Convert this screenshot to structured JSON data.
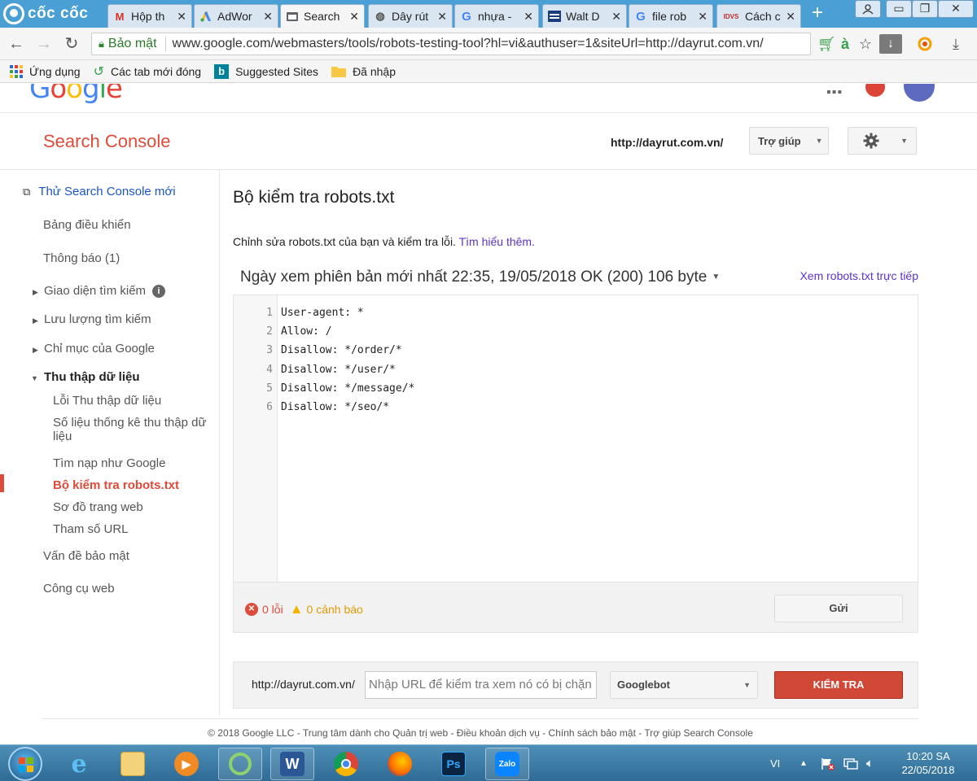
{
  "browser": {
    "brand": "cốc cốc",
    "tabs": [
      {
        "label": "Hộp th",
        "icon": "gmail-icon"
      },
      {
        "label": "AdWor",
        "icon": "adwords-icon"
      },
      {
        "label": "Search",
        "icon": "search-console-icon"
      },
      {
        "label": "Dây rút",
        "icon": "site-icon"
      },
      {
        "label": "nhựa -",
        "icon": "google-icon"
      },
      {
        "label": "Walt D",
        "icon": "news-icon"
      },
      {
        "label": "file rob",
        "icon": "google-icon"
      },
      {
        "label": "Cách c",
        "icon": "idvs-icon"
      }
    ],
    "idvs_text": "IDVS",
    "secure_label": "Bảo mật",
    "url": "www.google.com/webmasters/tools/robots-testing-tool?hl=vi&authuser=1&siteUrl=http://dayrut.com.vn/",
    "addon_letter": "à",
    "bookmarks": [
      {
        "label": "Ứng dụng",
        "icon": "apps-grid-icon"
      },
      {
        "label": "Các tab mới đóng",
        "icon": "restore-icon"
      },
      {
        "label": "Suggested Sites",
        "icon": "bing-icon"
      },
      {
        "label": "Đã nhập",
        "icon": "folder-icon"
      }
    ]
  },
  "header": {
    "logo": "Google",
    "app_title": "Search Console",
    "site_url": "http://dayrut.com.vn/",
    "help_label": "Trợ giúp"
  },
  "sidebar": {
    "new_console": "Thử Search Console mới",
    "items": [
      {
        "label": "Bảng điều khiển"
      },
      {
        "label": "Thông báo (1)"
      },
      {
        "label": "Giao diện tìm kiếm"
      },
      {
        "label": "Lưu lượng tìm kiếm"
      },
      {
        "label": "Chỉ mục của Google"
      },
      {
        "label": "Thu thập dữ liệu"
      },
      {
        "label": "Lỗi Thu thập dữ liệu"
      },
      {
        "label": "Số liệu thống kê thu thập dữ"
      },
      {
        "label": "liệu"
      },
      {
        "label": "Tìm nạp như Google"
      },
      {
        "label": "Bộ kiểm tra robots.txt"
      },
      {
        "label": "Sơ đồ trang web"
      },
      {
        "label": "Tham số URL"
      },
      {
        "label": "Vấn đề bảo mật"
      },
      {
        "label": "Công cụ web"
      }
    ]
  },
  "main": {
    "title": "Bộ kiểm tra robots.txt",
    "description": "Chỉnh sửa robots.txt của bạn và kiểm tra lỗi.",
    "learn_more": "Tìm hiểu thêm.",
    "version_line": "Ngày xem phiên bản mới nhất 22:35, 19/05/2018 OK (200) 106 byte",
    "live_link": "Xem robots.txt trực tiếp",
    "code_lines": [
      {
        "num": "1",
        "text": "User-agent: *"
      },
      {
        "num": "2",
        "text": "Allow: /"
      },
      {
        "num": "3",
        "text": "Disallow: */order/*"
      },
      {
        "num": "4",
        "text": "Disallow: */user/*"
      },
      {
        "num": "5",
        "text": "Disallow: */message/*"
      },
      {
        "num": "6",
        "text": "Disallow: */seo/*"
      }
    ],
    "errors": "0 lỗi",
    "warnings": "0 cảnh báo",
    "submit_label": "Gửi",
    "test": {
      "prefix": "http://dayrut.com.vn/",
      "placeholder": "Nhập URL để kiểm tra xem nó có bị chặn",
      "bot": "Googlebot",
      "button": "KIỂM TRA"
    }
  },
  "footer": "© 2018 Google LLC - Trung tâm dành cho Quản trị web - Điều khoản dịch vụ - Chính sách bảo mật - Trợ giúp Search Console",
  "taskbar": {
    "apps": [
      "internet-explorer",
      "file-explorer",
      "media-player",
      "coccoc",
      "word",
      "chrome",
      "firefox",
      "photoshop",
      "zalo"
    ],
    "word_letter": "W",
    "ps_letter": "Ps",
    "zalo_label": "Zalo",
    "language": "VI",
    "time": "10:20 SA",
    "date": "22/05/2018"
  },
  "colors": {
    "accent_red": "#dd4b39",
    "link_blue": "#1a55c4",
    "link_purple": "#5b33c4",
    "chrome_blue": "#4aa0d5"
  }
}
